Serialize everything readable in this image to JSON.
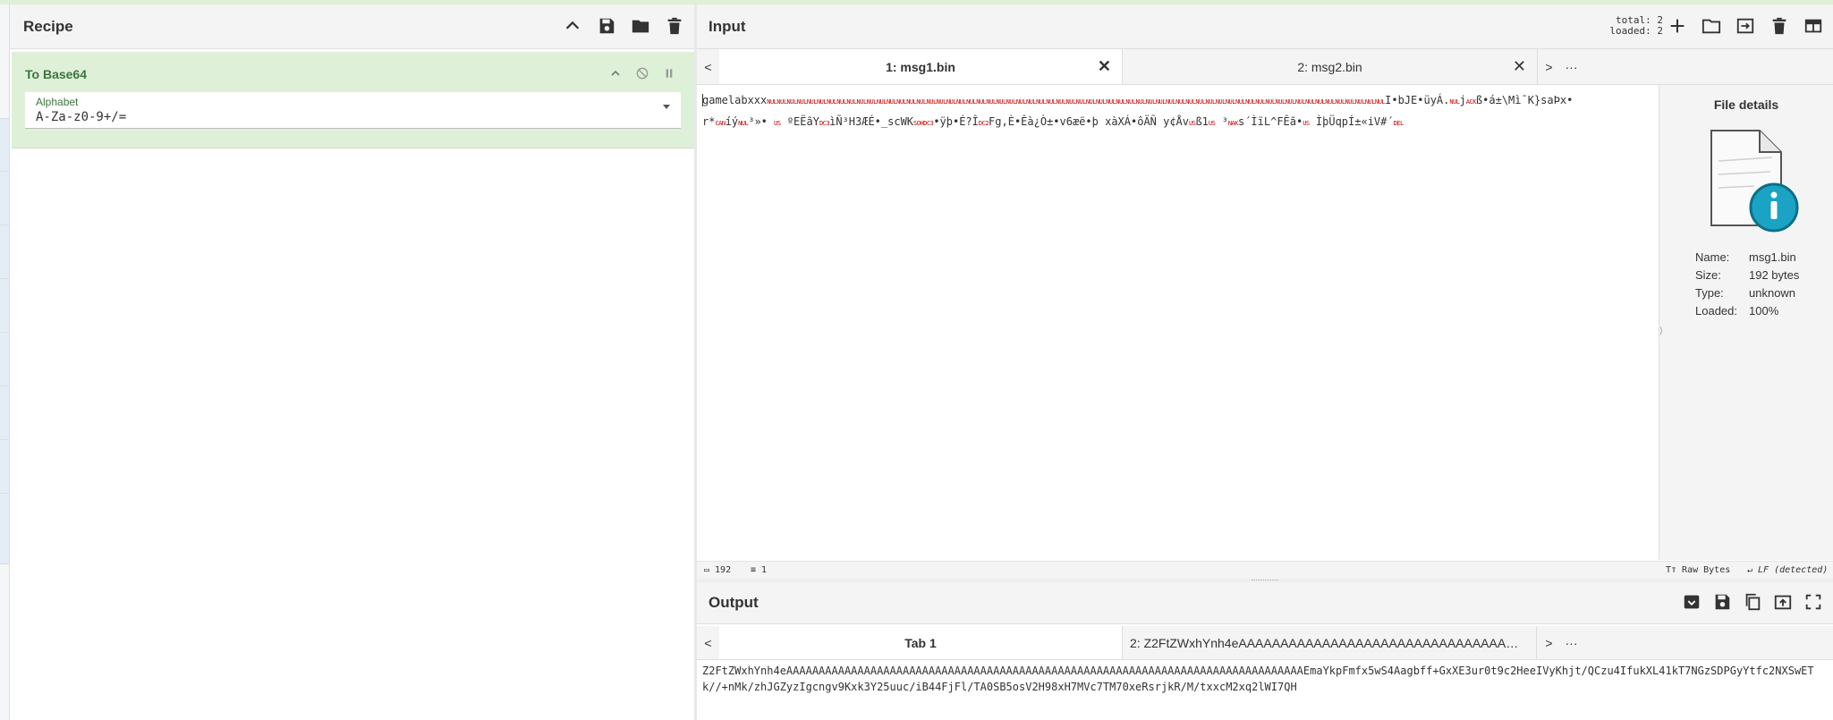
{
  "recipe": {
    "title": "Recipe",
    "icons": [
      "chevron-up-icon",
      "save-icon",
      "folder-icon",
      "trash-icon"
    ],
    "operation": {
      "name": "To Base64",
      "field_label": "Alphabet",
      "field_value": "A-Za-z0-9+/="
    }
  },
  "input": {
    "title": "Input",
    "info": {
      "total": "total:  2",
      "loaded": "loaded:  2"
    },
    "tabs": [
      {
        "label": "1: msg1.bin",
        "active": true
      },
      {
        "label": "2: msg2.bin",
        "active": false
      }
    ],
    "tab_prev": "<",
    "tab_next": ">",
    "tab_more": "···",
    "text_line1_prefix": "gamelabxxx",
    "text_line1_mid": "I•bJE•üyÁ.",
    "text_line1_b": "ß•á±\\Mì¯K}saÞx•",
    "text_line2_a": "r*",
    "text_line2_b": "íý",
    "text_line2_c": "³»•",
    "text_line2_d": "ºEËãY",
    "text_line2_e": "ìÑ³H3ÆÉ•_scWK",
    "text_line2_f": "•ÿþ•É?Î",
    "text_line2_g": "Fg,È•Êà¿Ò±•v6æë•þ xàXÁ•ôÄÑ y¢Åv",
    "text_line2_h": "ß1",
    "text_line2_i": "³",
    "text_line2_j": "s´ÌïL^FÊã•",
    "text_line2_k": "ÌþÜqpÍ±«iV#´",
    "status": {
      "chars": "192",
      "lines": "1",
      "encoding": "Raw Bytes",
      "eol": "LF (detected)"
    },
    "details": {
      "title": "File details",
      "name_label": "Name:",
      "name": "msg1.bin",
      "size_label": "Size:",
      "size": "192 bytes",
      "type_label": "Type:",
      "type": "unknown",
      "loaded_label": "Loaded:",
      "loaded": "100%"
    }
  },
  "output": {
    "title": "Output",
    "tabs": [
      {
        "label": "Tab 1",
        "active": true
      },
      {
        "label": "2: Z2FtZWxhYnh4eAAAAAAAAAAAAAAAAAAAAAAAAAAAAAAAAAAAAAAAAAAAAAAAAAAAAAA...",
        "active": false
      }
    ],
    "text": "Z2FtZWxhYnh4eAAAAAAAAAAAAAAAAAAAAAAAAAAAAAAAAAAAAAAAAAAAAAAAAAAAAAAAAAAAAAAAAAAAAAAAAAAAAAAAAEmaYkpFmfx5wS4Aagbff+GxXE3ur0t9c2HeeIVyKhjt/QCzu4IfukXL41kT7NGzSDPGyYtfc2NXSwET\nk//+nMk/zhJGZyzIgcngv9Kxk3Y25uuc/iB44FjFl/TA0SB5osV2H98xH7MVc7TM70xeRsrjkR/M/txxcM2xq2lWI7QH"
  },
  "colors": {
    "accent_green": "#dff0d8",
    "control_red": "#cc0000"
  }
}
